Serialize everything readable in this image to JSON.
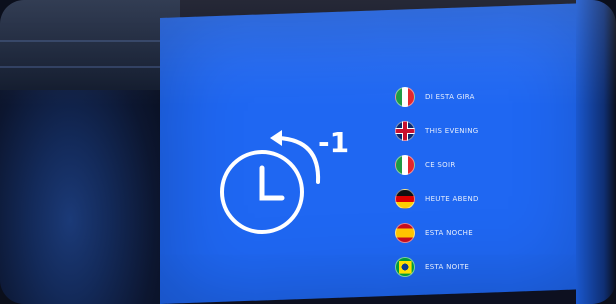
{
  "screen": {
    "offset_label": "-1",
    "languages": [
      {
        "flag_icon": "italy-flag-icon",
        "text": "DI ESTA GIRA"
      },
      {
        "flag_icon": "uk-flag-icon",
        "text": "THIS EVENING"
      },
      {
        "flag_icon": "italy-flag-icon",
        "text": "CE SOIR"
      },
      {
        "flag_icon": "germany-flag-icon",
        "text": "HEUTE ABEND"
      },
      {
        "flag_icon": "spain-flag-icon",
        "text": "ESTA NOCHE"
      },
      {
        "flag_icon": "brazil-flag-icon",
        "text": "ESTA NOITE"
      }
    ]
  },
  "colors": {
    "screen_blue": "#1f67f2",
    "icon_white": "#ffffff"
  }
}
